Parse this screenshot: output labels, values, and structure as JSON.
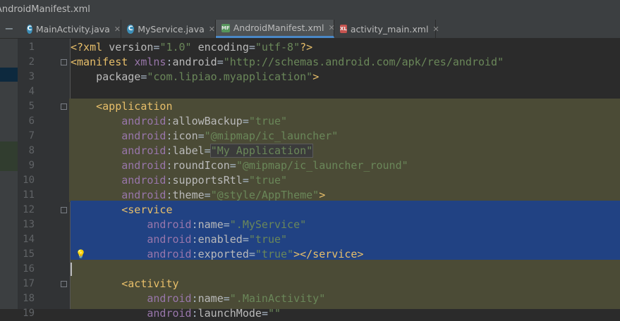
{
  "window": {
    "title": "AndroidManifest.xml"
  },
  "tabs": [
    {
      "label": "MainActivity.java",
      "icon": "c-class-icon",
      "active": false
    },
    {
      "label": "MyService.java",
      "icon": "c-class-icon",
      "active": false
    },
    {
      "label": "AndroidManifest.xml",
      "icon": "manifest-xml-icon",
      "active": true
    },
    {
      "label": "activity_main.xml",
      "icon": "layout-xml-icon",
      "active": false
    }
  ],
  "editor": {
    "lines": [
      {
        "n": "1",
        "text": "<?xml version=\"1.0\" encoding=\"utf-8\"?>"
      },
      {
        "n": "2",
        "text": "<manifest xmlns:android=\"http://schemas.android.com/apk/res/android\""
      },
      {
        "n": "3",
        "text": "    package=\"com.lipiao.myapplication\">"
      },
      {
        "n": "4",
        "text": ""
      },
      {
        "n": "5",
        "text": "    <application"
      },
      {
        "n": "6",
        "text": "        android:allowBackup=\"true\""
      },
      {
        "n": "7",
        "text": "        android:icon=\"@mipmap/ic_launcher\""
      },
      {
        "n": "8",
        "text": "        android:label=\"My Application\""
      },
      {
        "n": "9",
        "text": "        android:roundIcon=\"@mipmap/ic_launcher_round\""
      },
      {
        "n": "10",
        "text": "        android:supportsRtl=\"true\""
      },
      {
        "n": "11",
        "text": "        android:theme=\"@style/AppTheme\">"
      },
      {
        "n": "12",
        "text": "        <service"
      },
      {
        "n": "13",
        "text": "            android:name=\".MyService\""
      },
      {
        "n": "14",
        "text": "            android:enabled=\"true\""
      },
      {
        "n": "15",
        "text": "            android:exported=\"true\"></service>"
      },
      {
        "n": "16",
        "text": ""
      },
      {
        "n": "17",
        "text": "        <activity"
      },
      {
        "n": "18",
        "text": "            android:name=\".MainActivity\""
      },
      {
        "n": "19",
        "text": "            android:launchMode=\"\""
      }
    ]
  },
  "colors": {
    "tag": "#e8bf6a",
    "value": "#6a8759",
    "namespace": "#9876aa",
    "selection": "#214283"
  }
}
